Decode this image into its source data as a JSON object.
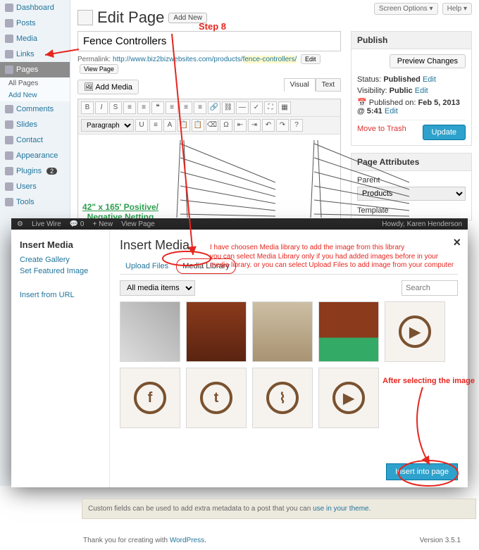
{
  "sidebar": {
    "items": [
      {
        "label": "Dashboard",
        "name": "dashboard"
      },
      {
        "label": "Posts",
        "name": "posts"
      },
      {
        "label": "Media",
        "name": "media"
      },
      {
        "label": "Links",
        "name": "links"
      },
      {
        "label": "Pages",
        "name": "pages",
        "active": true
      },
      {
        "label": "Comments",
        "name": "comments"
      },
      {
        "label": "Slides",
        "name": "slides"
      },
      {
        "label": "Contact",
        "name": "contact"
      },
      {
        "label": "Appearance",
        "name": "appearance"
      },
      {
        "label": "Plugins",
        "name": "plugins",
        "badge": "2"
      },
      {
        "label": "Users",
        "name": "users"
      },
      {
        "label": "Tools",
        "name": "tools"
      }
    ],
    "subs": {
      "all": "All Pages",
      "add": "Add New"
    }
  },
  "topopts": {
    "screen": "Screen Options ▾",
    "help": "Help ▾"
  },
  "page": {
    "title": "Edit Page",
    "addnew": "Add New",
    "doc_title": "Fence Controllers",
    "permalink_label": "Permalink:",
    "permalink_base": "http://www.biz2bizwebsites.com/products/",
    "permalink_slug": "fence-controllers/",
    "edit": "Edit",
    "view": "View Page",
    "addmedia": "🖼 Add Media",
    "tab_visual": "Visual",
    "tab_text": "Text",
    "paragraph": "Paragraph",
    "caption": "42\" x 165' Positive/\nNegative Netting"
  },
  "publish": {
    "heading": "Publish",
    "preview": "Preview Changes",
    "status_l": "Status:",
    "status_v": "Published",
    "edit": "Edit",
    "vis_l": "Visibility:",
    "vis_v": "Public",
    "pub_l": "Published on:",
    "pub_v": "Feb 5, 2013 @ 5:41",
    "trash": "Move to Trash",
    "update": "Update"
  },
  "attrs": {
    "heading": "Page Attributes",
    "parent": "Parent",
    "parent_v": "Products",
    "template": "Template"
  },
  "adminbar": {
    "site": "Live Wire",
    "comments": "0",
    "new": "+ New",
    "viewpage": "View Page",
    "howdy": "Howdy, Karen Henderson"
  },
  "modal": {
    "side_h": "Insert Media",
    "side_links": [
      "Create Gallery",
      "Set Featured Image"
    ],
    "side_url": "Insert from URL",
    "title": "Insert Media",
    "close": "×",
    "tab_upload": "Upload Files",
    "tab_library": "Media Library",
    "filter": "All media items",
    "search_ph": "Search",
    "insert": "Insert into page"
  },
  "strip": {
    "text": "Custom fields can be used to add extra metadata to a post that you can ",
    "link": "use in your theme"
  },
  "footer": {
    "thank": "Thank you for creating with ",
    "wp": "WordPress",
    "version": "Version 3.5.1"
  },
  "annotations": {
    "step": "Step 8",
    "note1": "I have choosen Media library to add the image from this library\nyou can select Media Library only if you had added images before in your\nmedia library. or you can select Upload Files to add image from your computer",
    "note2": "After selecting the image"
  }
}
